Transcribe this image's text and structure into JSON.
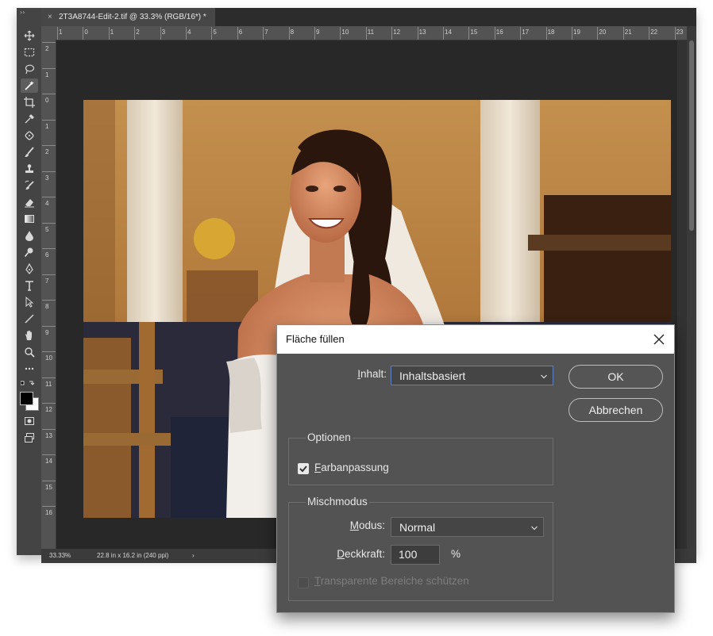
{
  "document_tab": {
    "close": "×",
    "title": "2T3A8744-Edit-2.tif @ 33.3% (RGB/16*) *"
  },
  "toolbar": {
    "grip": "››",
    "tools": [
      "move-icon",
      "marquee-icon",
      "lasso-icon",
      "magic-wand-icon",
      "crop-icon",
      "eyedropper-icon",
      "healing-brush-icon",
      "brush-icon",
      "clone-stamp-icon",
      "history-brush-icon",
      "eraser-icon",
      "gradient-icon",
      "blur-icon",
      "dodge-icon",
      "pen-icon",
      "type-icon",
      "path-selection-icon",
      "line-icon",
      "hand-icon",
      "zoom-icon",
      "more-tools-icon"
    ]
  },
  "ruler_h": [
    "1",
    "0",
    "1",
    "2",
    "3",
    "4",
    "5",
    "6",
    "7",
    "8",
    "9",
    "10",
    "11",
    "12",
    "13",
    "14",
    "15",
    "16",
    "17",
    "18",
    "19",
    "20",
    "21",
    "22",
    "23"
  ],
  "ruler_v": [
    "2",
    "1",
    "0",
    "1",
    "2",
    "3",
    "4",
    "5",
    "6",
    "7",
    "8",
    "9",
    "10",
    "11",
    "12",
    "13",
    "14",
    "15",
    "16"
  ],
  "status": {
    "zoom": "33.33%",
    "dimensions": "22.8 in x 16.2 in (240 ppi)",
    "arrow": "›"
  },
  "dialog": {
    "title": "Fläche füllen",
    "content_label_u": "I",
    "content_label_rest": "nhalt:",
    "content_value": "Inhaltsbasiert",
    "ok": "OK",
    "cancel": "Abbrechen",
    "options_group": "Optionen",
    "color_adapt_u": "F",
    "color_adapt_rest": "arbanpassung",
    "color_adapt_checked": true,
    "blend_group": "Mischmodus",
    "mode_label_u": "M",
    "mode_label_rest": "odus:",
    "mode_value": "Normal",
    "opacity_label_u": "D",
    "opacity_label_rest": "eckkraft:",
    "opacity_value": "100",
    "opacity_unit": "%",
    "preserve_u": "T",
    "preserve_rest": "ransparente Bereiche schützen",
    "preserve_checked": false
  },
  "colors": {
    "accent_focus": "#5d7fc4",
    "dialog_bg": "#535353",
    "app_bg": "#323232"
  }
}
